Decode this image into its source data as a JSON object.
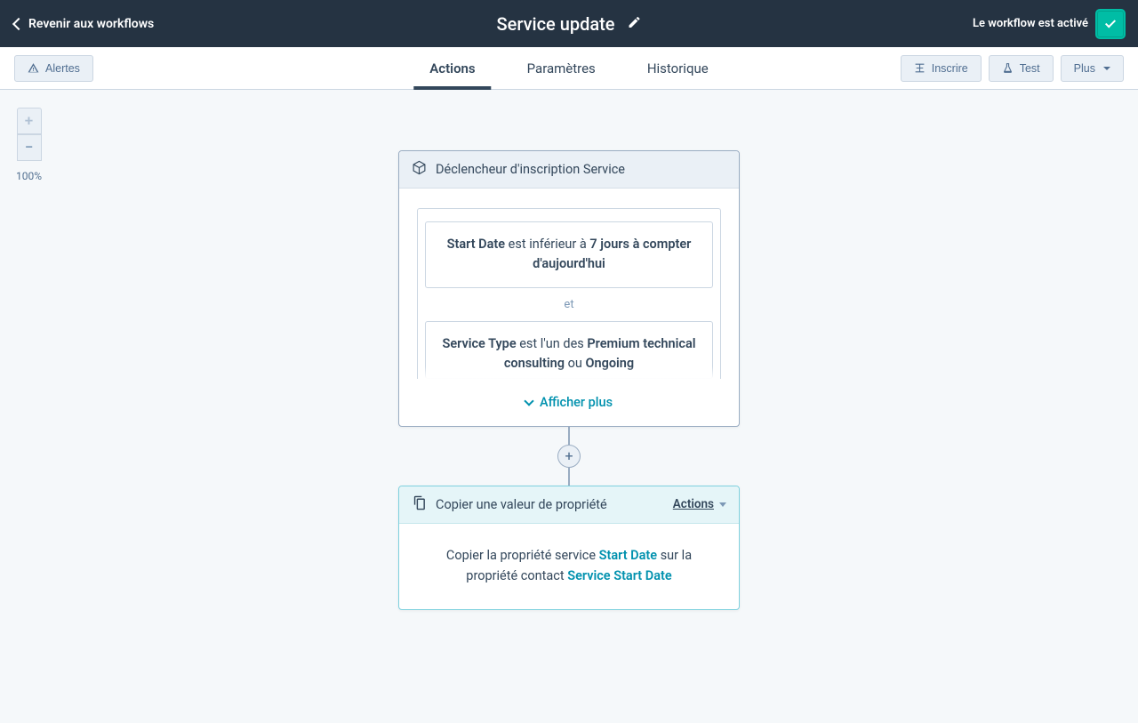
{
  "topbar": {
    "back_label": "Revenir aux workflows",
    "title": "Service update",
    "status_label": "Le workflow est activé"
  },
  "toolbar": {
    "alerts_label": "Alertes",
    "tabs": {
      "actions": "Actions",
      "settings": "Paramètres",
      "history": "Historique"
    },
    "enroll_label": "Inscrire",
    "test_label": "Test",
    "more_label": "Plus"
  },
  "zoom": {
    "level": "100%"
  },
  "trigger": {
    "header": "Déclencheur d'inscription Service",
    "filter1_prop": "Start Date",
    "filter1_mid": " est inférieur à ",
    "filter1_val": "7 jours à compter d'aujourd'hui",
    "and": "et",
    "filter2_prop": "Service Type",
    "filter2_mid": " est l'un des ",
    "filter2_v1": "Premium technical consulting",
    "filter2_sep": " ou ",
    "filter2_v2": "Ongoing",
    "show_more": "Afficher plus"
  },
  "copy_step": {
    "header": "Copier une valeur de propriété",
    "actions_label": "Actions",
    "body_pre": "Copier la propriété service ",
    "body_prop1": "Start Date",
    "body_mid": " sur la propriété contact ",
    "body_prop2": "Service Start Date"
  }
}
